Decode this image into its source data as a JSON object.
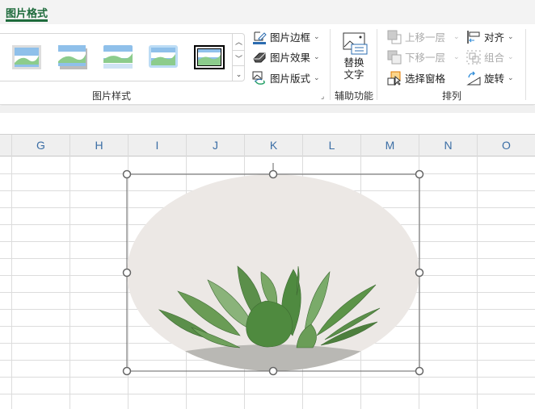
{
  "tab": {
    "label": "图片格式"
  },
  "picture_styles": {
    "group_label": "图片样式",
    "scroll_up": "︿",
    "scroll_down": "﹀",
    "more": "⌄"
  },
  "picture_buttons": {
    "border": "图片边框",
    "effects": "图片效果",
    "layout": "图片版式"
  },
  "accessibility": {
    "alt_text_line1": "替换",
    "alt_text_line2": "文字",
    "group_label": "辅助功能"
  },
  "arrange": {
    "bring_forward": "上移一层",
    "send_backward": "下移一层",
    "selection_pane": "选择窗格",
    "align": "对齐",
    "group": "组合",
    "rotate": "旋转",
    "group_label": "排列"
  },
  "chevron": "⌄",
  "columns": [
    "G",
    "H",
    "I",
    "J",
    "K",
    "L",
    "M",
    "N",
    "O"
  ],
  "colors": {
    "accent": "#1e6b3c",
    "header_letter": "#3b6ea5"
  }
}
